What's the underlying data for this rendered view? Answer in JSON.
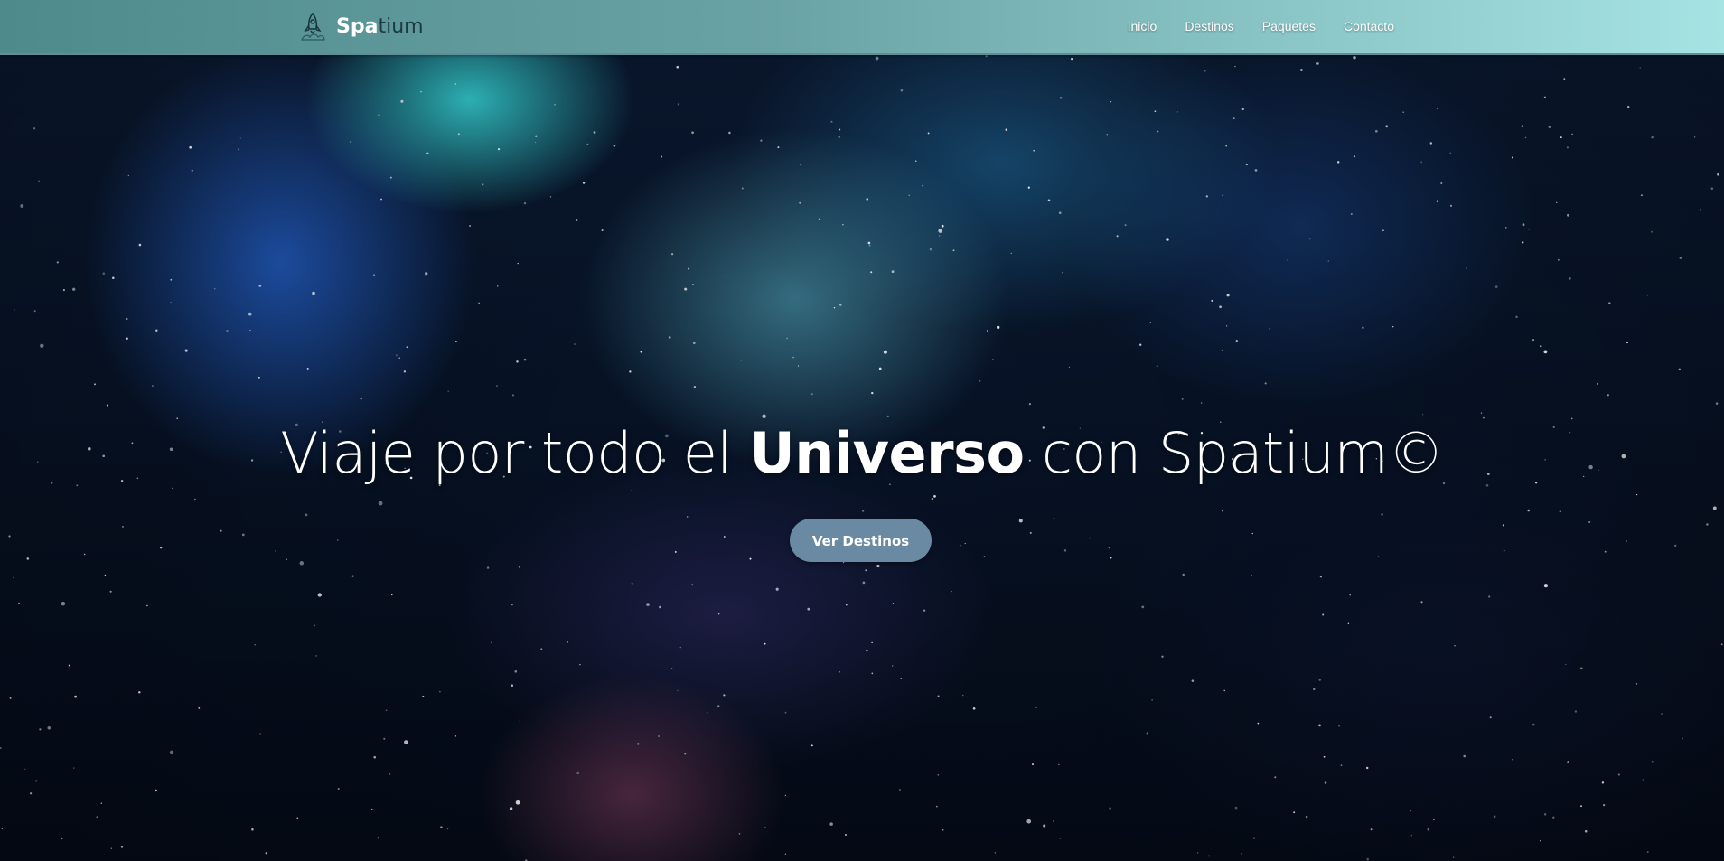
{
  "navbar": {
    "brand": {
      "strong": "Spa",
      "light": "tium",
      "icon": "rocket-icon"
    },
    "links": [
      {
        "label": "Inicio"
      },
      {
        "label": "Destinos"
      },
      {
        "label": "Paquetes"
      },
      {
        "label": "Contacto"
      }
    ],
    "colors": {
      "gradient_start": "#4e8a8c",
      "gradient_end": "#a6e3e3"
    }
  },
  "hero": {
    "title_part1": "Viaje por todo el ",
    "title_bold": "Universo",
    "title_part2": " con Spatium©",
    "cta_label": "Ver Destinos",
    "cta_color": "#6a8aa3",
    "background": "starry-nebula"
  }
}
